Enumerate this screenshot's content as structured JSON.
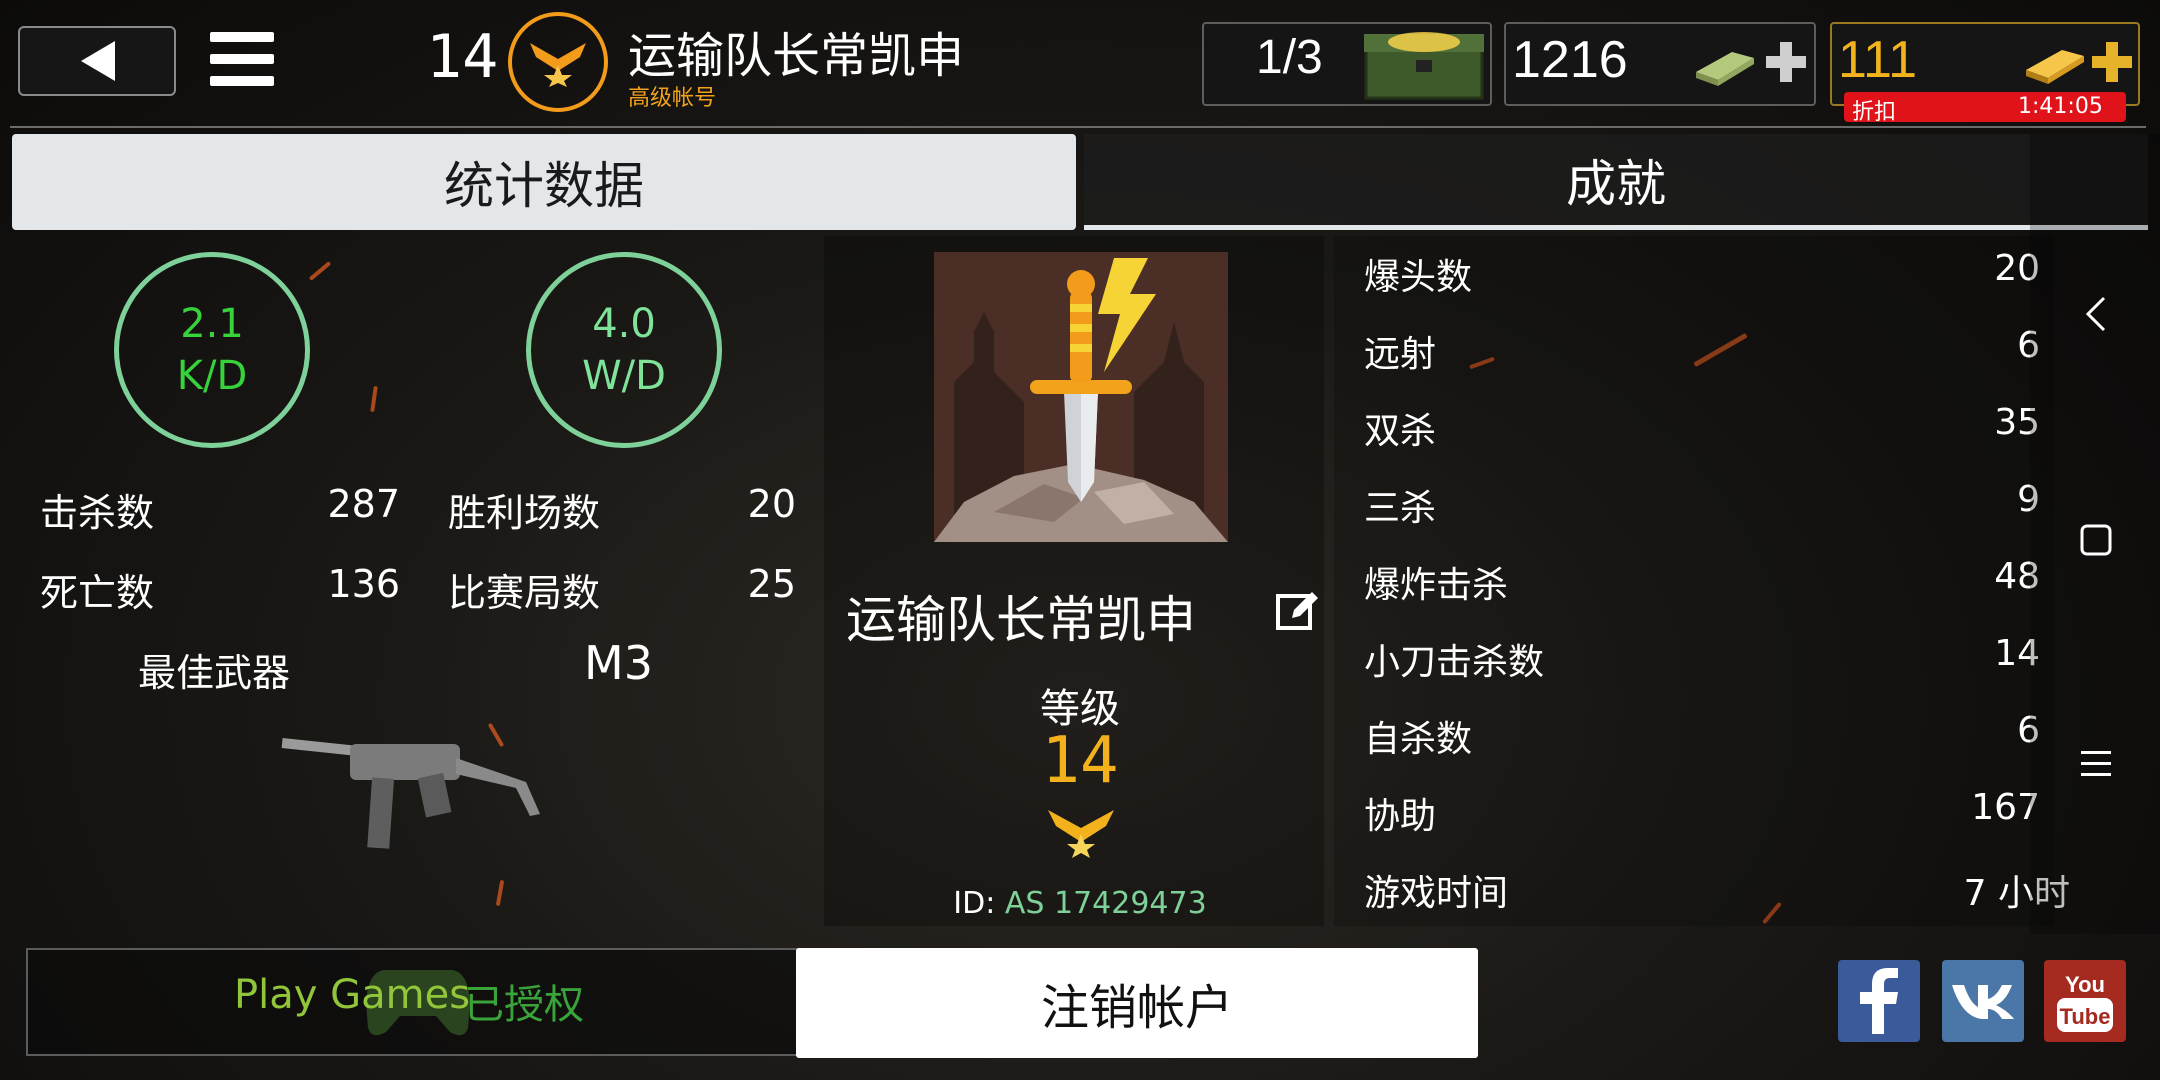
{
  "header": {
    "level": "14",
    "player_name": "运输队长常凯申",
    "account_type": "高级帐号",
    "chests": "1/3",
    "cash": "1216",
    "gold": "111",
    "discount_label": "折扣",
    "discount_timer": "1:41:05"
  },
  "tabs": {
    "stats": "统计数据",
    "achievements": "成就"
  },
  "rings": {
    "kd_value": "2.1",
    "kd_label": "K/D",
    "wd_value": "4.0",
    "wd_label": "W/D"
  },
  "stats": {
    "kills_label": "击杀数",
    "kills": "287",
    "deaths_label": "死亡数",
    "deaths": "136",
    "wins_label": "胜利场数",
    "wins": "20",
    "matches_label": "比赛局数",
    "matches": "25",
    "best_weapon_label": "最佳武器",
    "best_weapon": "M3"
  },
  "profile": {
    "name": "运输队长常凯申",
    "level_label": "等级",
    "level": "14",
    "id_prefix": "ID: ",
    "id": "AS 17429473"
  },
  "achievements": [
    {
      "label": "爆头数",
      "value": "20"
    },
    {
      "label": "远射",
      "value": "6"
    },
    {
      "label": "双杀",
      "value": "35"
    },
    {
      "label": "三杀",
      "value": "9"
    },
    {
      "label": "爆炸击杀",
      "value": "48"
    },
    {
      "label": "小刀击杀数",
      "value": "14"
    },
    {
      "label": "自杀数",
      "value": "6"
    },
    {
      "label": "协助",
      "value": "167"
    },
    {
      "label": "游戏时间",
      "value": "7 小时"
    }
  ],
  "bottom": {
    "play_games": "Play Games",
    "play_games_status": "已授权",
    "logout": "注销帐户"
  },
  "colors": {
    "accent_gold": "#f3b21c",
    "ring_green": "#7fd19a",
    "discount_red": "#e0131a"
  }
}
